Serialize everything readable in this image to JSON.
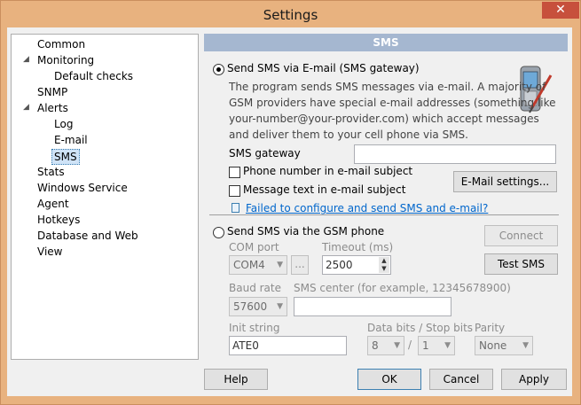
{
  "window": {
    "title": "Settings",
    "close_symbol": "✕"
  },
  "tree": {
    "items": [
      {
        "label": "Common"
      },
      {
        "label": "Monitoring"
      },
      {
        "label": "Default checks"
      },
      {
        "label": "SNMP"
      },
      {
        "label": "Alerts"
      },
      {
        "label": "Log"
      },
      {
        "label": "E-mail"
      },
      {
        "label": "SMS"
      },
      {
        "label": "Stats"
      },
      {
        "label": "Windows Service"
      },
      {
        "label": "Agent"
      },
      {
        "label": "Hotkeys"
      },
      {
        "label": "Database and Web"
      },
      {
        "label": "View"
      }
    ],
    "selected": "SMS"
  },
  "panel": {
    "header": "SMS"
  },
  "email_gateway": {
    "radio_label": "Send SMS via E-mail (SMS gateway)",
    "selected": true,
    "description": "The program sends SMS messages via e-mail. A majority of GSM providers have special e-mail addresses (something like your-number@your-provider.com) which accept messages and deliver them to your cell phone via SMS.",
    "gateway_label": "SMS gateway",
    "gateway_value": "",
    "phone_in_subject_label": "Phone number in e-mail subject",
    "phone_in_subject_checked": false,
    "text_in_subject_label": "Message text in e-mail subject",
    "text_in_subject_checked": false,
    "email_settings_button": "E-Mail settings...",
    "help_link": "Failed to configure and send SMS and e-mail?"
  },
  "gsm_phone": {
    "radio_label": "Send SMS via the GSM phone",
    "selected": false,
    "connect_button": "Connect",
    "test_button": "Test SMS",
    "com_port_label": "COM port",
    "com_port_value": "COM4",
    "browse_button": "...",
    "timeout_label": "Timeout (ms)",
    "timeout_value": "2500",
    "baud_rate_label": "Baud rate",
    "baud_rate_value": "57600",
    "sms_center_label": "SMS center (for example, 12345678900)",
    "sms_center_value": "",
    "init_string_label": "Init string",
    "init_string_value": "ATE0",
    "data_stop_bits_label": "Data bits / Stop bits",
    "data_bits_value": "8",
    "slash": "/",
    "stop_bits_value": "1",
    "parity_label": "Parity",
    "parity_value": "None"
  },
  "footer": {
    "help_button": "Help",
    "ok_button": "OK",
    "cancel_button": "Cancel",
    "apply_button": "Apply"
  }
}
